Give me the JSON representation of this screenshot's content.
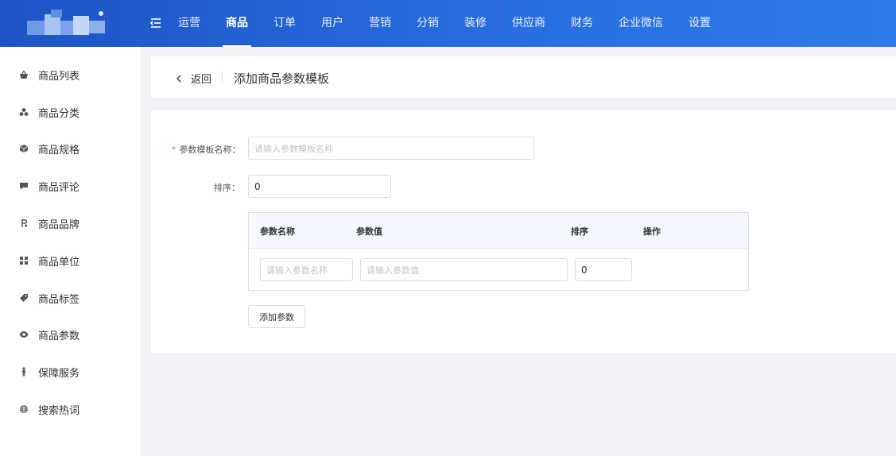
{
  "colors": {
    "topbar_start": "#1d54c4",
    "topbar_end": "#2f7ae6",
    "required": "#f56c6c",
    "table_header_bg": "#f5f8fe"
  },
  "nav": {
    "toggle_icon": "menu-fold-icon",
    "items": [
      {
        "label": "运营"
      },
      {
        "label": "商品",
        "active": true
      },
      {
        "label": "订单"
      },
      {
        "label": "用户"
      },
      {
        "label": "营销"
      },
      {
        "label": "分销"
      },
      {
        "label": "装修"
      },
      {
        "label": "供应商"
      },
      {
        "label": "财务"
      },
      {
        "label": "企业微信"
      },
      {
        "label": "设置"
      }
    ]
  },
  "sidebar": {
    "items": [
      {
        "label": "商品列表",
        "icon": "basket-icon"
      },
      {
        "label": "商品分类",
        "icon": "category-icon"
      },
      {
        "label": "商品规格",
        "icon": "cube-icon"
      },
      {
        "label": "商品评论",
        "icon": "comment-icon"
      },
      {
        "label": "商品品牌",
        "icon": "brand-icon"
      },
      {
        "label": "商品单位",
        "icon": "grid-icon"
      },
      {
        "label": "商品标签",
        "icon": "tag-icon"
      },
      {
        "label": "商品参数",
        "icon": "eye-icon"
      },
      {
        "label": "保障服务",
        "icon": "person-icon"
      },
      {
        "label": "搜索热词",
        "icon": "globe-icon"
      }
    ]
  },
  "header": {
    "back_label": "返回",
    "title": "添加商品参数模板"
  },
  "form": {
    "name_label": "参数模板名称：",
    "name_required_mark": "*",
    "name_placeholder": "请输入参数模板名称",
    "name_value": "",
    "sort_label": "排序：",
    "sort_value": "0",
    "table": {
      "headers": [
        "参数名称",
        "参数值",
        "排序",
        "操作"
      ],
      "row": {
        "name_placeholder": "请输入参数名称",
        "value_placeholder": "请输入参数值",
        "sort_value": "0"
      }
    },
    "add_button_label": "添加参数"
  }
}
